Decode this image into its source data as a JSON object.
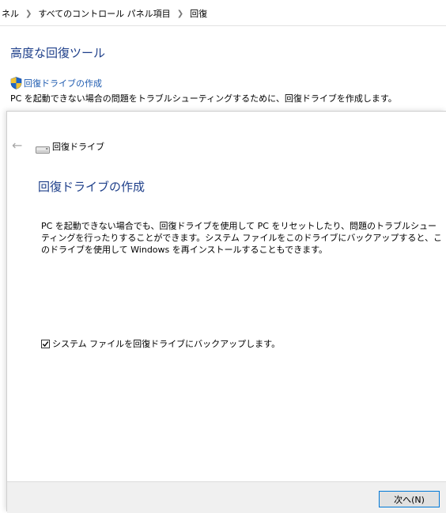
{
  "breadcrumb": {
    "items": [
      "ネル",
      "すべてのコントロール パネル項目",
      "回復"
    ]
  },
  "control_panel": {
    "title": "高度な回復ツール",
    "link_label": "回復ドライブの作成",
    "link_description": "PC を起動できない場合の問題をトラブルシューティングするために、回復ドライブを作成します。"
  },
  "dialog": {
    "header_title": "回復ドライブ",
    "title": "回復ドライブの作成",
    "body_text": "PC を起動できない場合でも、回復ドライブを使用して PC をリセットしたり、問題のトラブルシューティングを行ったりすることができます。システム ファイルをこのドライブにバックアップすると、このドライブを使用して Windows を再インストールすることもできます。",
    "backup_checkbox_label": "システム ファイルを回復ドライブにバックアップします。",
    "backup_checked": true,
    "next_button_label": "次へ(N)"
  },
  "icons": {
    "back": "back-arrow-icon",
    "drive": "drive-icon",
    "shield": "uac-shield-icon",
    "separator": "chevron-right-icon",
    "check": "checkmark-icon"
  },
  "colors": {
    "title_blue": "#1e3f8a",
    "link_blue": "#1e5bb0",
    "button_border": "#0078d7",
    "footer_bg": "#f0f0f0"
  }
}
